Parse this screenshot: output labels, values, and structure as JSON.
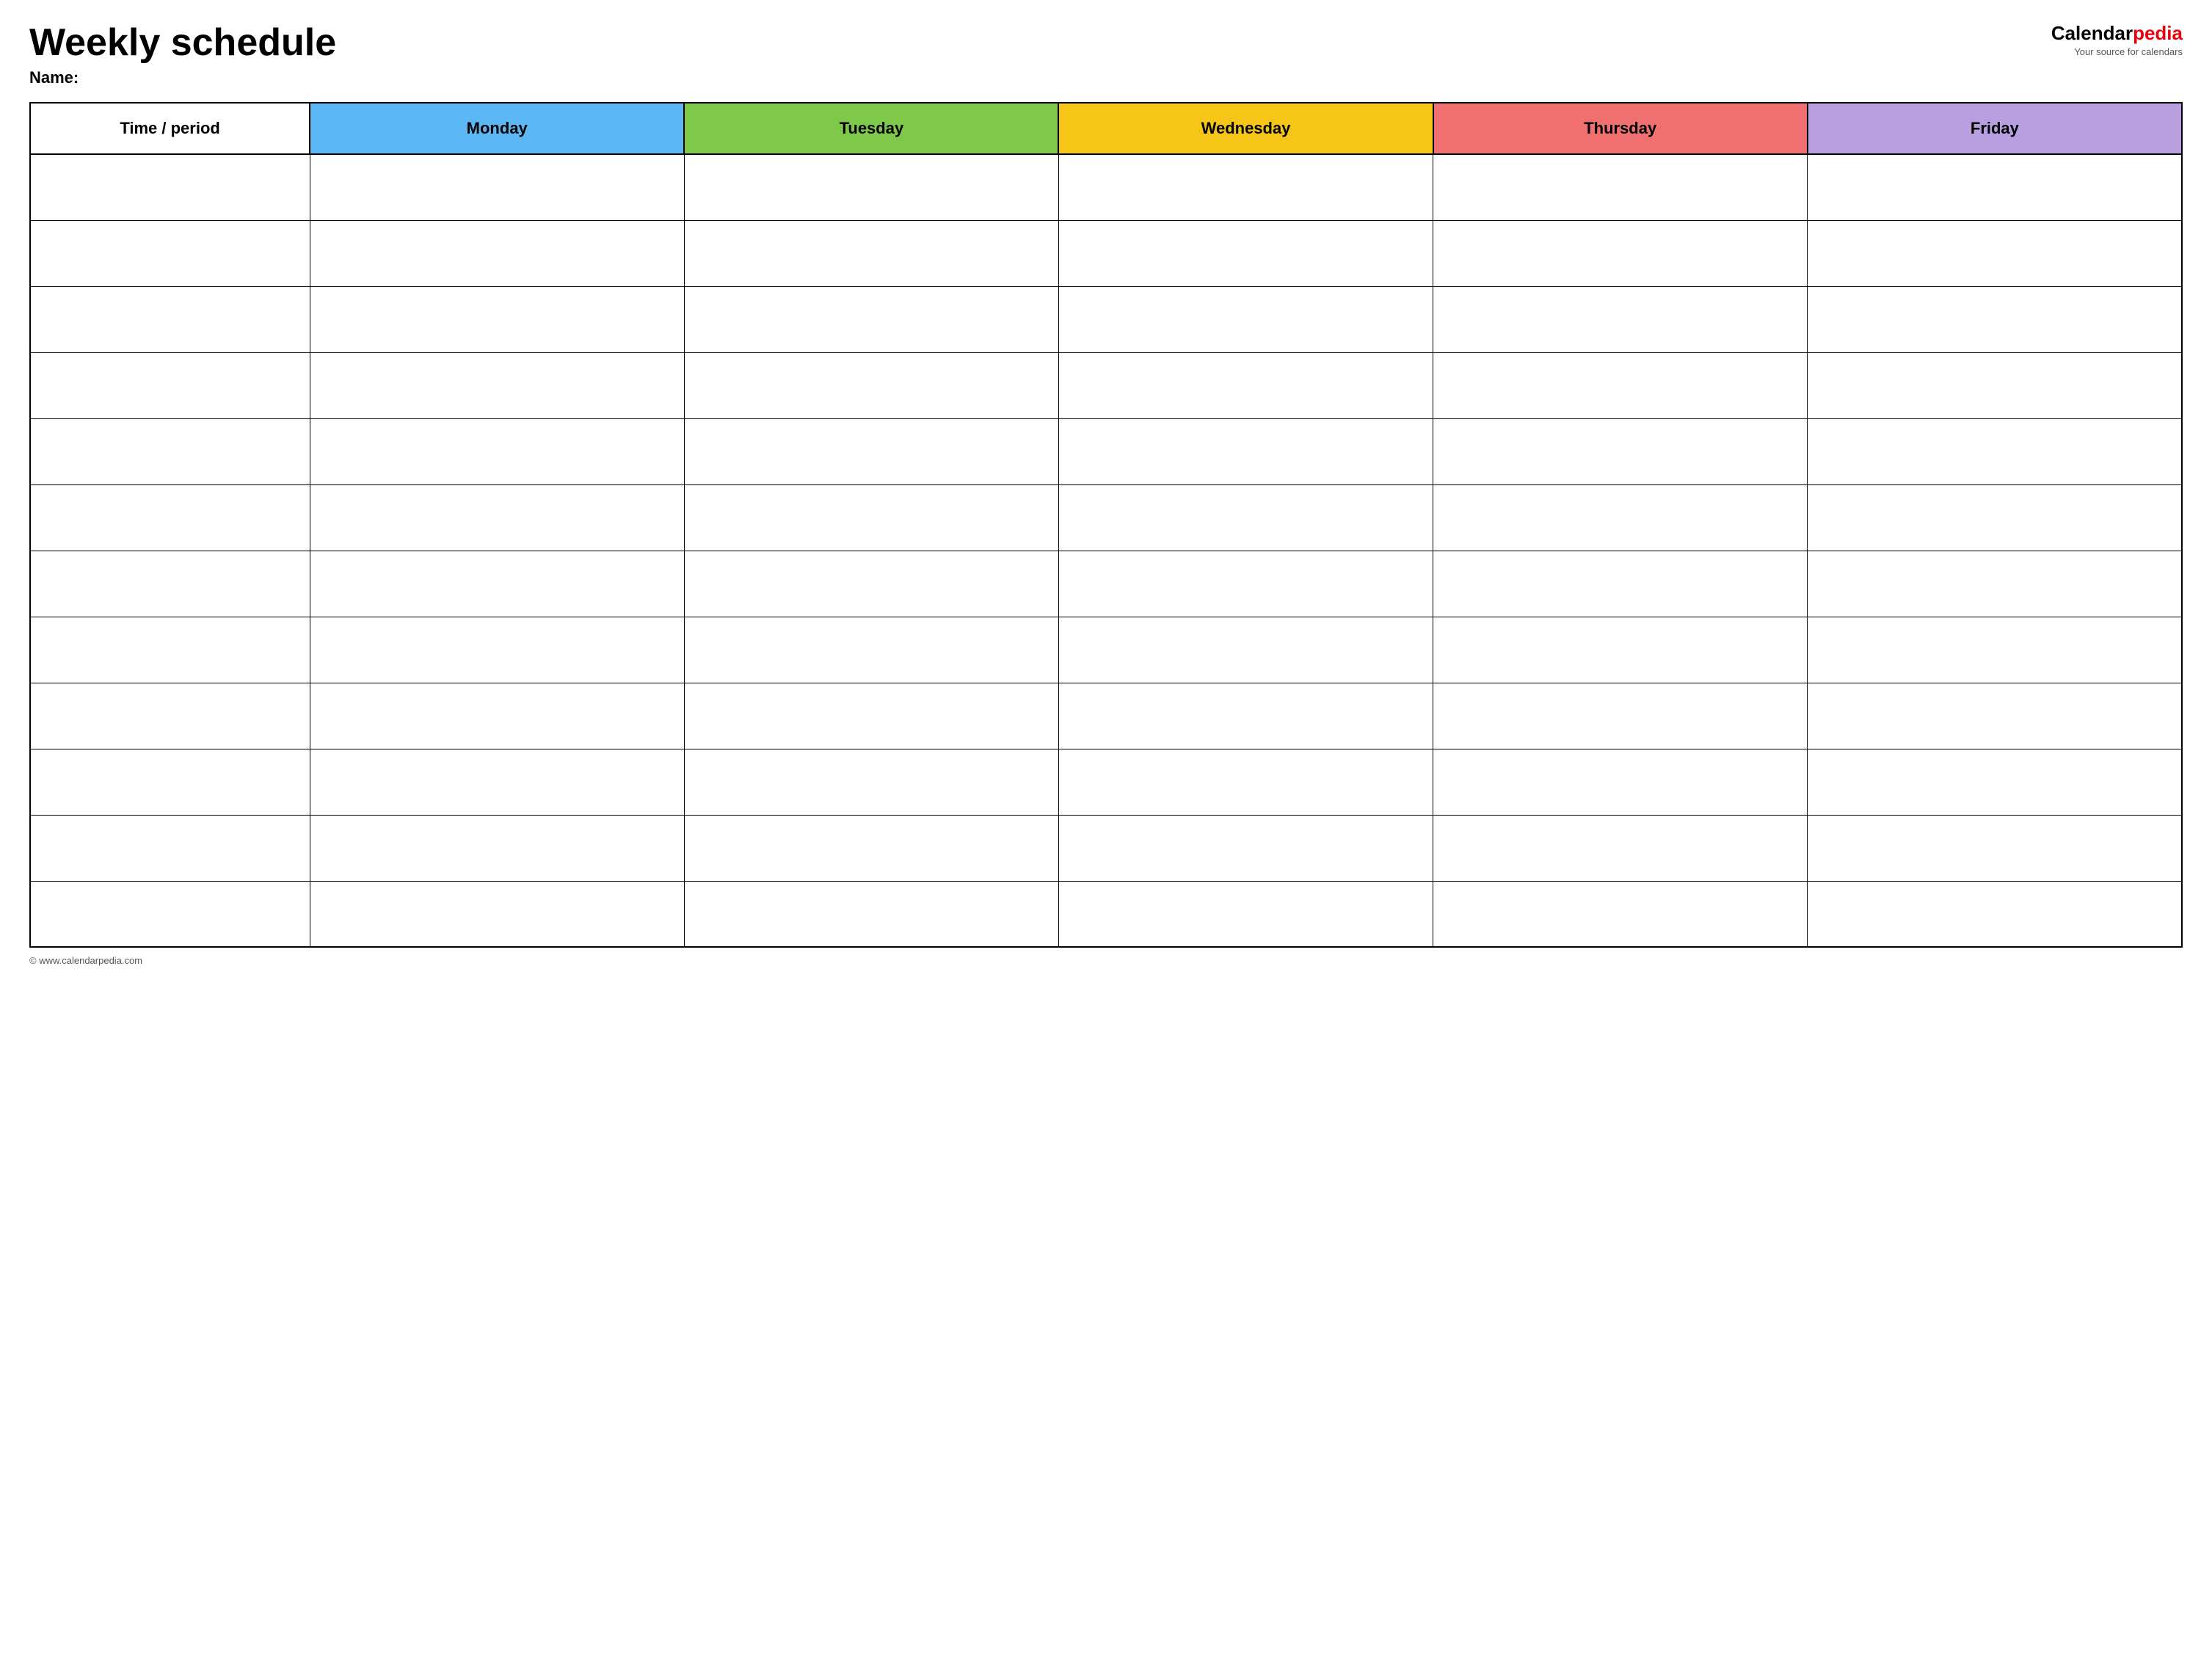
{
  "header": {
    "title": "Weekly schedule",
    "name_label": "Name:",
    "logo_calendar": "Calendar",
    "logo_pedia": "pedia",
    "logo_tagline": "Your source for calendars"
  },
  "table": {
    "columns": [
      {
        "key": "time",
        "label": "Time / period",
        "color": "#ffffff"
      },
      {
        "key": "monday",
        "label": "Monday",
        "color": "#5bb8f5"
      },
      {
        "key": "tuesday",
        "label": "Tuesday",
        "color": "#7ec84a"
      },
      {
        "key": "wednesday",
        "label": "Wednesday",
        "color": "#f5c518"
      },
      {
        "key": "thursday",
        "label": "Thursday",
        "color": "#f07070"
      },
      {
        "key": "friday",
        "label": "Friday",
        "color": "#b89fe0"
      }
    ],
    "row_count": 12
  },
  "footer": {
    "url": "© www.calendarpedia.com"
  }
}
